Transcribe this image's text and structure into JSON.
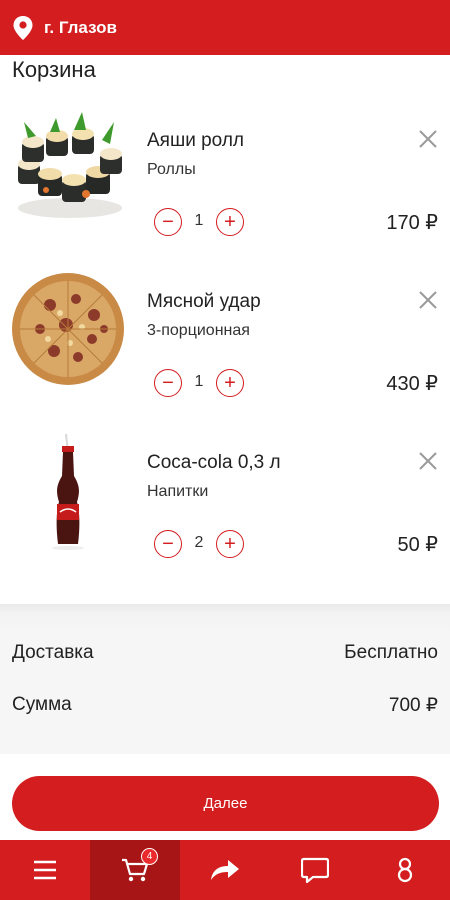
{
  "header": {
    "city": "г. Глазов"
  },
  "page": {
    "title": "Корзина"
  },
  "cart": {
    "items": [
      {
        "name": "Аяши ролл",
        "category": "Роллы",
        "qty": "1",
        "price": "170 ₽"
      },
      {
        "name": "Мясной удар",
        "category": "3-порционная",
        "qty": "1",
        "price": "430 ₽"
      },
      {
        "name": "Coca-cola 0,3 л",
        "category": "Напитки",
        "qty": "2",
        "price": "50 ₽"
      }
    ]
  },
  "summary": {
    "delivery_label": "Доставка",
    "delivery_value": "Бесплатно",
    "sum_label": "Сумма",
    "sum_value": "700 ₽"
  },
  "next_label": "Далее",
  "nav": {
    "cart_badge": "4",
    "items": [
      {
        "icon": "menu-icon"
      },
      {
        "icon": "cart-icon",
        "active": true
      },
      {
        "icon": "share-icon"
      },
      {
        "icon": "chat-icon"
      },
      {
        "icon": "profile-icon"
      }
    ]
  },
  "colors": {
    "brand": "#d31d1f",
    "brand_dark": "#a81517"
  }
}
